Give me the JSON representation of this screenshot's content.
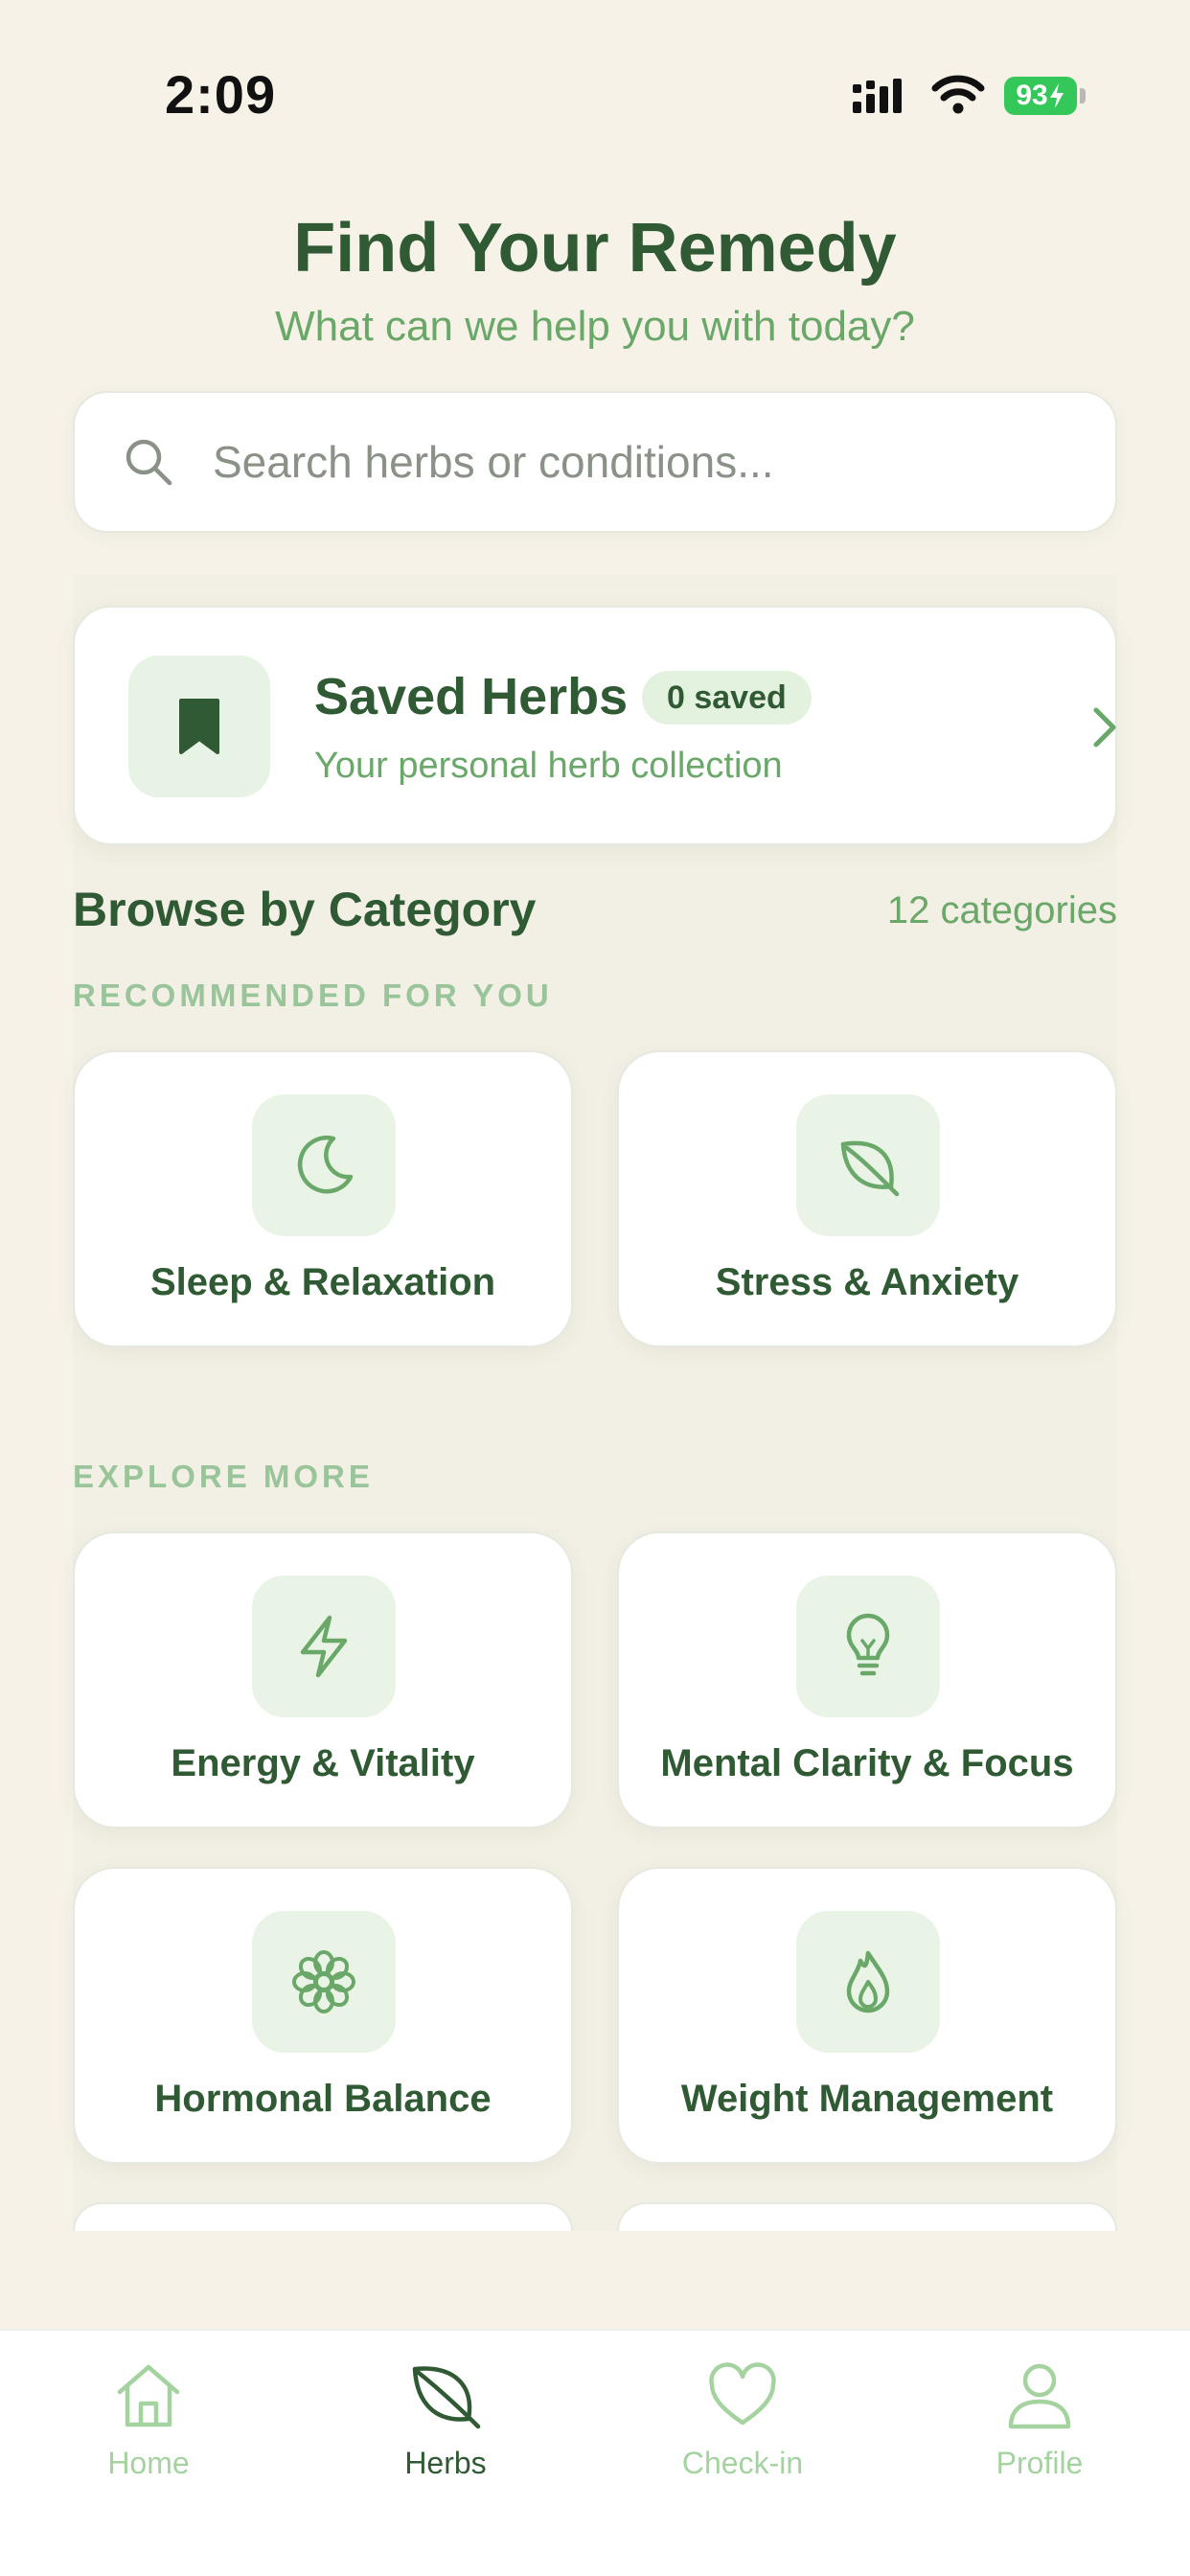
{
  "status_bar": {
    "time": "2:09",
    "battery": "93"
  },
  "header": {
    "title": "Find Your Remedy",
    "subtitle": "What can we help you with today?"
  },
  "search": {
    "placeholder": "Search herbs or conditions...",
    "value": ""
  },
  "saved_herbs": {
    "title": "Saved Herbs",
    "badge": "0 saved",
    "subtitle": "Your personal herb collection"
  },
  "browse": {
    "title": "Browse by Category",
    "count": "12 categories",
    "recommended_label": "RECOMMENDED FOR YOU",
    "explore_label": "EXPLORE MORE",
    "recommended": [
      {
        "label": "Sleep & Relaxation",
        "icon": "moon-icon"
      },
      {
        "label": "Stress & Anxiety",
        "icon": "leaf-icon"
      }
    ],
    "explore": [
      {
        "label": "Energy & Vitality",
        "icon": "lightning-icon"
      },
      {
        "label": "Mental Clarity & Focus",
        "icon": "lightbulb-icon"
      },
      {
        "label": "Hormonal Balance",
        "icon": "flower-icon"
      },
      {
        "label": "Weight Management",
        "icon": "flame-icon"
      }
    ]
  },
  "tab_bar": {
    "active": "Herbs",
    "tabs": [
      {
        "label": "Home",
        "icon": "home-icon"
      },
      {
        "label": "Herbs",
        "icon": "leaf-icon"
      },
      {
        "label": "Check-in",
        "icon": "heart-icon"
      },
      {
        "label": "Profile",
        "icon": "person-icon"
      }
    ]
  },
  "colors": {
    "background": "#f6f2e8",
    "primary_text": "#2f5a33",
    "accent": "#6aa869",
    "tile": "#e9f4e6",
    "inactive_tab": "#a4d3a0",
    "battery": "#34c759"
  }
}
